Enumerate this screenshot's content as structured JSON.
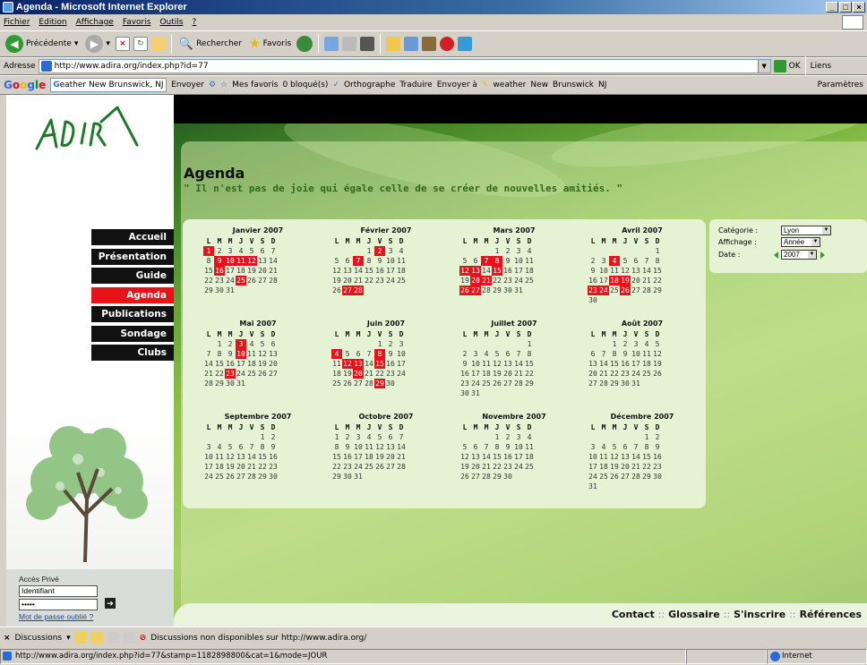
{
  "window": {
    "title": "Agenda - Microsoft Internet Explorer",
    "controls": [
      "_",
      "□",
      "×"
    ]
  },
  "menu": [
    "Fichier",
    "Edition",
    "Affichage",
    "Favoris",
    "Outils",
    "?"
  ],
  "toolbar": {
    "back": "Précédente",
    "search": "Rechercher",
    "favorites": "Favoris"
  },
  "address": {
    "label": "Adresse",
    "url": "http://www.adira.org/index.php?id=77",
    "go": "OK",
    "links": "Liens"
  },
  "google": {
    "logo": "Google",
    "search_value": "eather New Brunswick, NJ",
    "send": "Envoyer",
    "favs": "Mes favoris",
    "blocked": "0 bloqué(s)",
    "spell": "Orthographe",
    "translate": "Traduire",
    "send_to": "Envoyer à",
    "links": [
      "weather",
      "New",
      "Brunswick",
      "NJ"
    ],
    "settings": "Paramètres"
  },
  "site": {
    "logo_text": "ADIRA",
    "nav": [
      "Accueil",
      "Présentation",
      "Guide",
      "Agenda",
      "Publications",
      "Sondage",
      "Clubs"
    ],
    "nav_active": "Agenda",
    "login": {
      "title": "Accès Privé",
      "user_value": "Identifiant",
      "password_value": "•••••",
      "forgot": "Mot de passe oublié ?"
    },
    "page_title": "Agenda",
    "quote": "\" Il n'est pas de joie qui égale celle de se créer de nouvelles amitiés. \"",
    "weekdays": [
      "L",
      "M",
      "M",
      "J",
      "V",
      "S",
      "D"
    ],
    "months": [
      {
        "name": "Janvier 2007",
        "offset": 0,
        "days": 31,
        "events": [
          1,
          9,
          10,
          11,
          12,
          16,
          25
        ]
      },
      {
        "name": "Février 2007",
        "offset": 3,
        "days": 28,
        "events": [
          2,
          7,
          27,
          28
        ]
      },
      {
        "name": "Mars 2007",
        "offset": 3,
        "days": 31,
        "events": [
          7,
          8,
          12,
          13,
          15,
          20,
          21,
          26,
          27
        ]
      },
      {
        "name": "Avril 2007",
        "offset": 6,
        "days": 30,
        "events": [
          4,
          18,
          19,
          23,
          24,
          26
        ]
      },
      {
        "name": "Mai 2007",
        "offset": 1,
        "days": 31,
        "events": [
          3,
          10,
          23
        ]
      },
      {
        "name": "Juin 2007",
        "offset": 4,
        "days": 30,
        "events": [
          4,
          8,
          12,
          13,
          15,
          20,
          29
        ]
      },
      {
        "name": "Juillet 2007",
        "offset": 6,
        "days": 31,
        "events": []
      },
      {
        "name": "Août 2007",
        "offset": 2,
        "days": 31,
        "events": []
      },
      {
        "name": "Septembre 2007",
        "offset": 5,
        "days": 30,
        "events": []
      },
      {
        "name": "Octobre 2007",
        "offset": 0,
        "days": 31,
        "events": []
      },
      {
        "name": "Novembre 2007",
        "offset": 3,
        "days": 30,
        "events": []
      },
      {
        "name": "Décembre 2007",
        "offset": 5,
        "days": 31,
        "events": []
      }
    ],
    "filters": {
      "category_label": "Catégorie :",
      "category_value": "Lyon",
      "display_label": "Affichage :",
      "display_value": "Année",
      "date_label": "Date :",
      "date_value": "2007"
    },
    "footer_links": [
      "Contact",
      "Glossaire",
      "S'inscrire",
      "Références"
    ],
    "footer_sep": "::"
  },
  "discussions": {
    "label": "Discussions",
    "status": "Discussions non disponibles sur http://www.adira.org/"
  },
  "status": {
    "url": "http://www.adira.org/index.php?id=77&stamp=1182898800&cat=1&mode=JOUR",
    "zone": "Internet"
  },
  "colors": {
    "accent_red": "#e8121a",
    "nav_black": "#111111",
    "quote_green": "#2e6a1a",
    "titlebar": "#0a246a"
  }
}
